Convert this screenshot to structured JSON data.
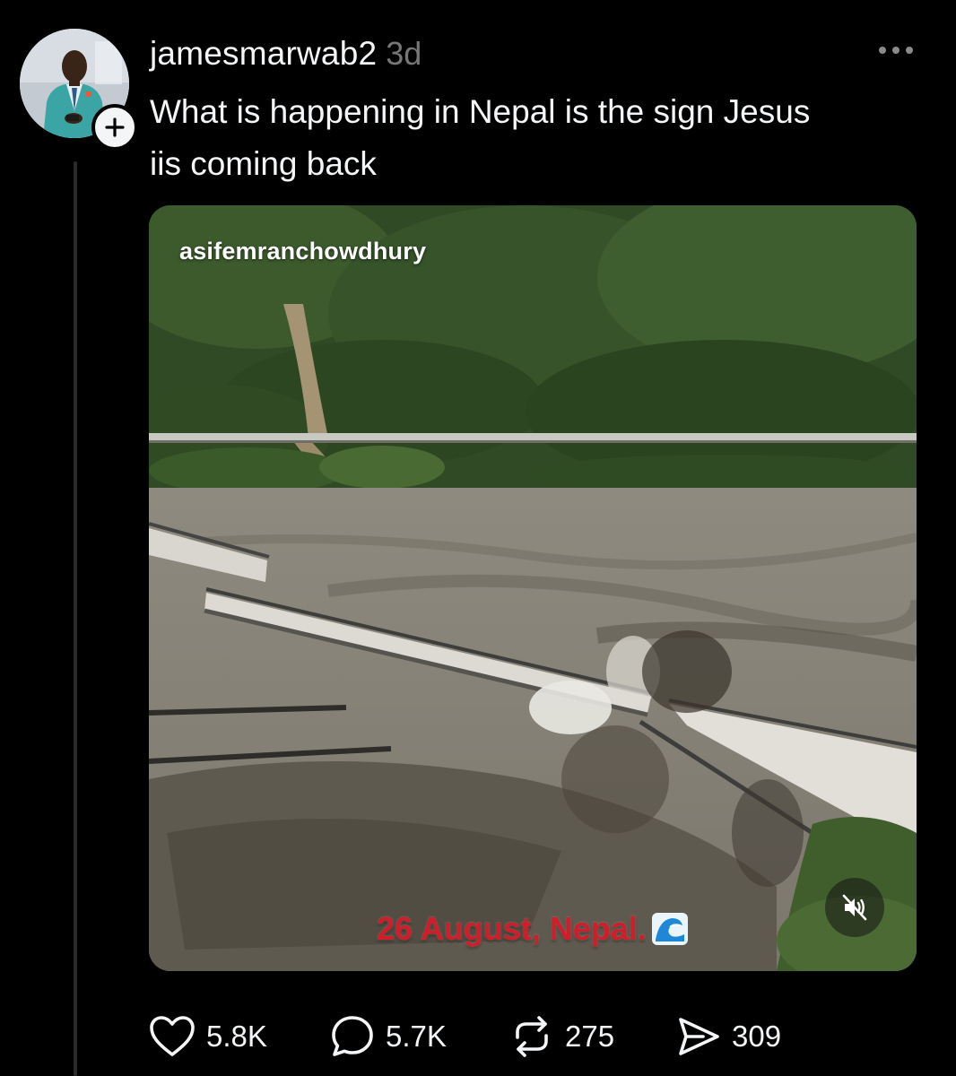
{
  "post": {
    "username": "jamesmarwab2",
    "timestamp": "3d",
    "text": "What is happening in Nepal is the sign Jesus\niis coming back"
  },
  "media": {
    "watermark": "asifemranchowdhury",
    "caption": "26 August, Nepal.",
    "caption_emoji": "wave-icon",
    "caption_color": "#d11d2a"
  },
  "actions": {
    "likes": "5.8K",
    "replies": "5.7K",
    "reposts": "275",
    "shares": "309"
  },
  "colors": {
    "background": "#000000",
    "text_primary": "#f3f5f7",
    "text_secondary": "#777777"
  }
}
